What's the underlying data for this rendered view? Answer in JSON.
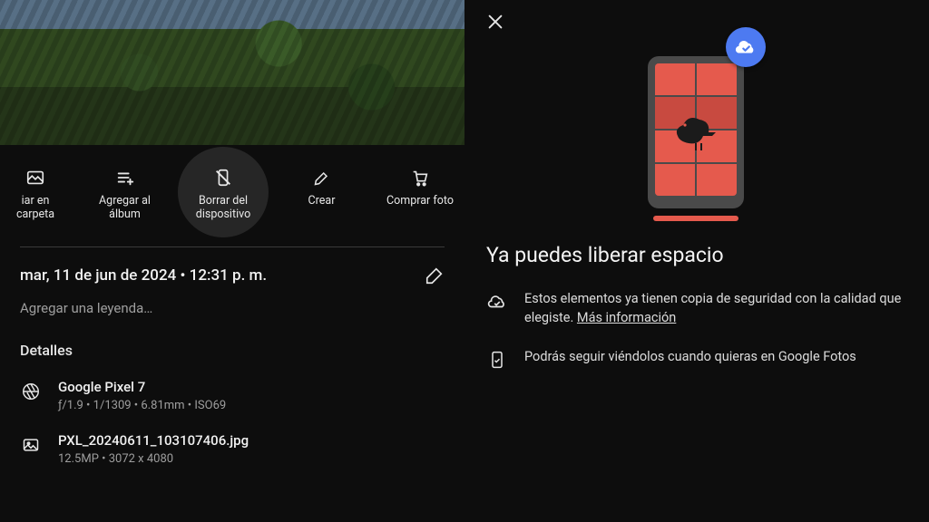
{
  "left": {
    "actions": {
      "copy": "iar en carpeta",
      "add_album": "Agregar al álbum",
      "delete_device": "Borrar del dispositivo",
      "create": "Crear",
      "buy": "Comprar foto"
    },
    "date_line": "mar, 11 de jun de 2024  •  12:31 p. m.",
    "caption_placeholder": "Agregar una leyenda…",
    "details_heading": "Detalles",
    "device": {
      "name": "Google Pixel 7",
      "meta": "ƒ/1.9  •  1/1309  •  6.81mm  •  ISO69"
    },
    "file": {
      "name": "PXL_20240611_103107406.jpg",
      "meta": "12.5MP  •  3072 x 4080"
    }
  },
  "right": {
    "title": "Ya puedes liberar espacio",
    "b1_prefix": "Estos elementos ya tienen copia de seguridad con la calidad que elegiste. ",
    "b1_link": "Más información",
    "b2": "Podrás seguir viéndolos cuando quieras en Google Fotos"
  }
}
